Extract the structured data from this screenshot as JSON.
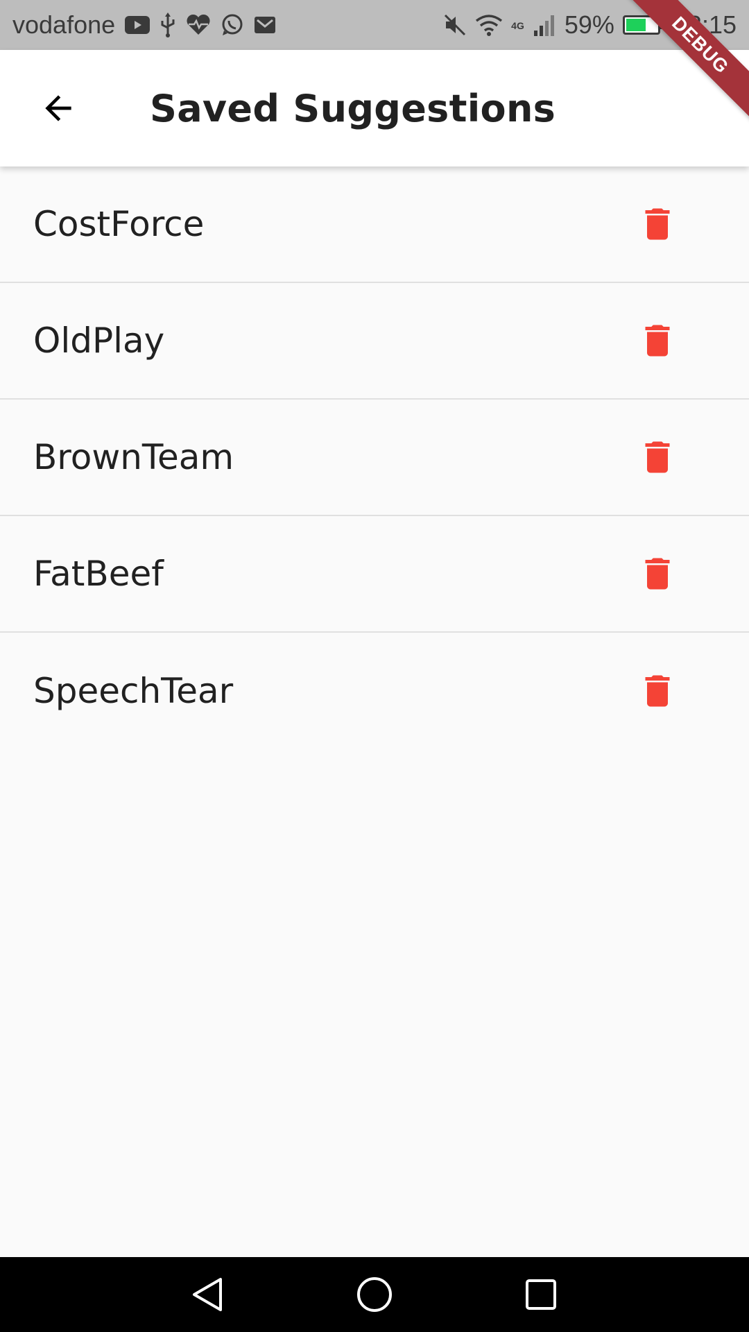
{
  "status_bar": {
    "carrier": "vodafone",
    "network": "4G",
    "battery_percent": "59%",
    "battery_level": 0.59,
    "time": "23:15",
    "left_icons": [
      "youtube-icon",
      "usb-icon",
      "health-icon",
      "whatsapp-icon",
      "gmail-icon"
    ],
    "right_icons": [
      "mute-icon",
      "wifi-icon",
      "signal-icon",
      "battery-icon"
    ]
  },
  "debug_ribbon": {
    "label": "DEBUG",
    "color": "#a4333a"
  },
  "app_bar": {
    "title": "Saved Suggestions",
    "back_icon": "arrow-back-icon"
  },
  "suggestions": [
    {
      "label": "CostForce",
      "action_icon": "delete-icon"
    },
    {
      "label": "OldPlay",
      "action_icon": "delete-icon"
    },
    {
      "label": "BrownTeam",
      "action_icon": "delete-icon"
    },
    {
      "label": "FatBeef",
      "action_icon": "delete-icon"
    },
    {
      "label": "SpeechTear",
      "action_icon": "delete-icon"
    }
  ],
  "colors": {
    "delete": "#f44336",
    "app_bar_bg": "#ffffff",
    "list_bg": "#fafafa",
    "divider": "#e0e0e0",
    "status_bar_bg": "#bdbdbd",
    "nav_bar_bg": "#000000"
  },
  "nav_bar": {
    "buttons": [
      "back-triangle-icon",
      "home-circle-icon",
      "recents-square-icon"
    ]
  }
}
